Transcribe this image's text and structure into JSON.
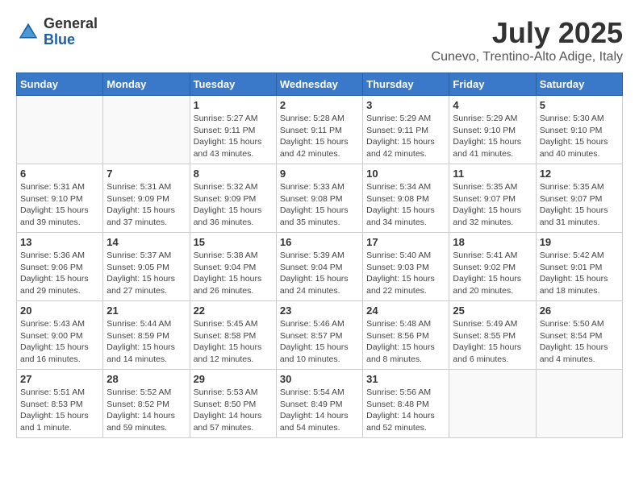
{
  "logo": {
    "general": "General",
    "blue": "Blue"
  },
  "title": "July 2025",
  "subtitle": "Cunevo, Trentino-Alto Adige, Italy",
  "days_of_week": [
    "Sunday",
    "Monday",
    "Tuesday",
    "Wednesday",
    "Thursday",
    "Friday",
    "Saturday"
  ],
  "weeks": [
    [
      {
        "day": "",
        "info": ""
      },
      {
        "day": "",
        "info": ""
      },
      {
        "day": "1",
        "info": "Sunrise: 5:27 AM\nSunset: 9:11 PM\nDaylight: 15 hours and 43 minutes."
      },
      {
        "day": "2",
        "info": "Sunrise: 5:28 AM\nSunset: 9:11 PM\nDaylight: 15 hours and 42 minutes."
      },
      {
        "day": "3",
        "info": "Sunrise: 5:29 AM\nSunset: 9:11 PM\nDaylight: 15 hours and 42 minutes."
      },
      {
        "day": "4",
        "info": "Sunrise: 5:29 AM\nSunset: 9:10 PM\nDaylight: 15 hours and 41 minutes."
      },
      {
        "day": "5",
        "info": "Sunrise: 5:30 AM\nSunset: 9:10 PM\nDaylight: 15 hours and 40 minutes."
      }
    ],
    [
      {
        "day": "6",
        "info": "Sunrise: 5:31 AM\nSunset: 9:10 PM\nDaylight: 15 hours and 39 minutes."
      },
      {
        "day": "7",
        "info": "Sunrise: 5:31 AM\nSunset: 9:09 PM\nDaylight: 15 hours and 37 minutes."
      },
      {
        "day": "8",
        "info": "Sunrise: 5:32 AM\nSunset: 9:09 PM\nDaylight: 15 hours and 36 minutes."
      },
      {
        "day": "9",
        "info": "Sunrise: 5:33 AM\nSunset: 9:08 PM\nDaylight: 15 hours and 35 minutes."
      },
      {
        "day": "10",
        "info": "Sunrise: 5:34 AM\nSunset: 9:08 PM\nDaylight: 15 hours and 34 minutes."
      },
      {
        "day": "11",
        "info": "Sunrise: 5:35 AM\nSunset: 9:07 PM\nDaylight: 15 hours and 32 minutes."
      },
      {
        "day": "12",
        "info": "Sunrise: 5:35 AM\nSunset: 9:07 PM\nDaylight: 15 hours and 31 minutes."
      }
    ],
    [
      {
        "day": "13",
        "info": "Sunrise: 5:36 AM\nSunset: 9:06 PM\nDaylight: 15 hours and 29 minutes."
      },
      {
        "day": "14",
        "info": "Sunrise: 5:37 AM\nSunset: 9:05 PM\nDaylight: 15 hours and 27 minutes."
      },
      {
        "day": "15",
        "info": "Sunrise: 5:38 AM\nSunset: 9:04 PM\nDaylight: 15 hours and 26 minutes."
      },
      {
        "day": "16",
        "info": "Sunrise: 5:39 AM\nSunset: 9:04 PM\nDaylight: 15 hours and 24 minutes."
      },
      {
        "day": "17",
        "info": "Sunrise: 5:40 AM\nSunset: 9:03 PM\nDaylight: 15 hours and 22 minutes."
      },
      {
        "day": "18",
        "info": "Sunrise: 5:41 AM\nSunset: 9:02 PM\nDaylight: 15 hours and 20 minutes."
      },
      {
        "day": "19",
        "info": "Sunrise: 5:42 AM\nSunset: 9:01 PM\nDaylight: 15 hours and 18 minutes."
      }
    ],
    [
      {
        "day": "20",
        "info": "Sunrise: 5:43 AM\nSunset: 9:00 PM\nDaylight: 15 hours and 16 minutes."
      },
      {
        "day": "21",
        "info": "Sunrise: 5:44 AM\nSunset: 8:59 PM\nDaylight: 15 hours and 14 minutes."
      },
      {
        "day": "22",
        "info": "Sunrise: 5:45 AM\nSunset: 8:58 PM\nDaylight: 15 hours and 12 minutes."
      },
      {
        "day": "23",
        "info": "Sunrise: 5:46 AM\nSunset: 8:57 PM\nDaylight: 15 hours and 10 minutes."
      },
      {
        "day": "24",
        "info": "Sunrise: 5:48 AM\nSunset: 8:56 PM\nDaylight: 15 hours and 8 minutes."
      },
      {
        "day": "25",
        "info": "Sunrise: 5:49 AM\nSunset: 8:55 PM\nDaylight: 15 hours and 6 minutes."
      },
      {
        "day": "26",
        "info": "Sunrise: 5:50 AM\nSunset: 8:54 PM\nDaylight: 15 hours and 4 minutes."
      }
    ],
    [
      {
        "day": "27",
        "info": "Sunrise: 5:51 AM\nSunset: 8:53 PM\nDaylight: 15 hours and 1 minute."
      },
      {
        "day": "28",
        "info": "Sunrise: 5:52 AM\nSunset: 8:52 PM\nDaylight: 14 hours and 59 minutes."
      },
      {
        "day": "29",
        "info": "Sunrise: 5:53 AM\nSunset: 8:50 PM\nDaylight: 14 hours and 57 minutes."
      },
      {
        "day": "30",
        "info": "Sunrise: 5:54 AM\nSunset: 8:49 PM\nDaylight: 14 hours and 54 minutes."
      },
      {
        "day": "31",
        "info": "Sunrise: 5:56 AM\nSunset: 8:48 PM\nDaylight: 14 hours and 52 minutes."
      },
      {
        "day": "",
        "info": ""
      },
      {
        "day": "",
        "info": ""
      }
    ]
  ]
}
